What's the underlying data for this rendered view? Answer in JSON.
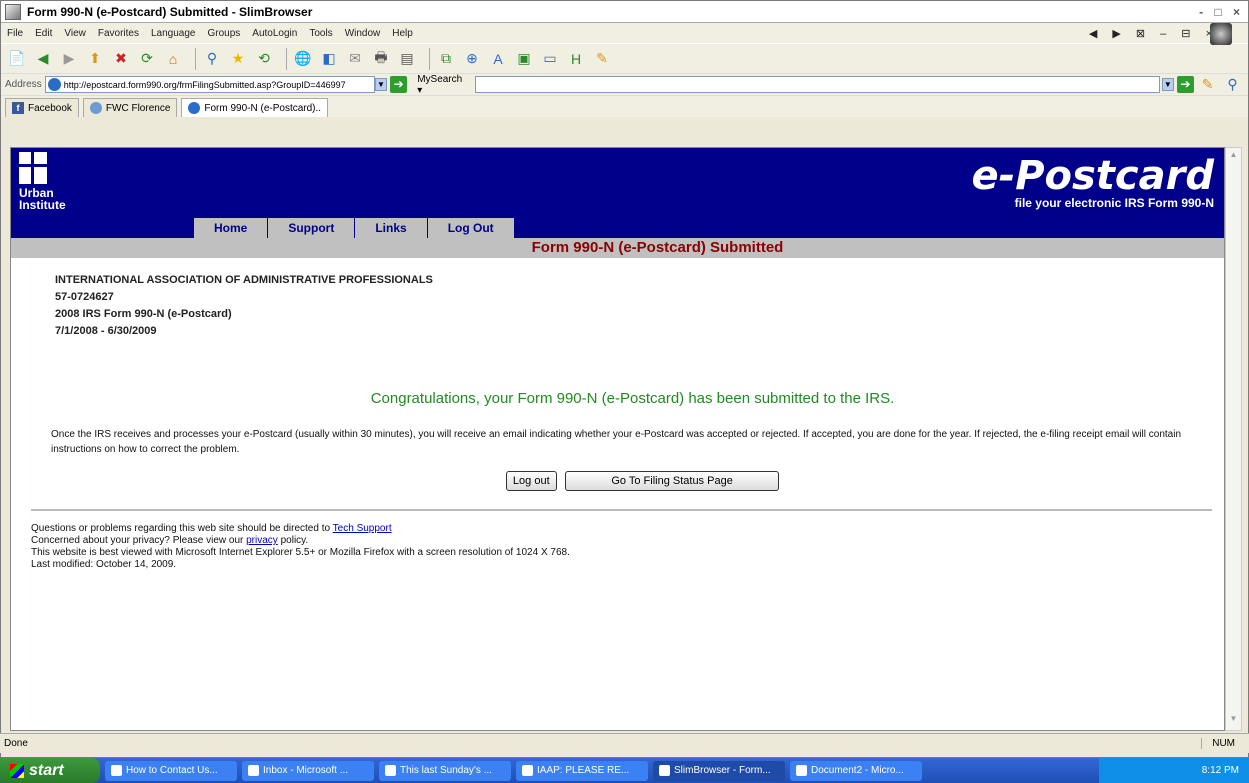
{
  "window": {
    "title": "Form 990-N (e-Postcard) Submitted - SlimBrowser",
    "controls": "- □ ×"
  },
  "menu": [
    "File",
    "Edit",
    "View",
    "Favorites",
    "Language",
    "Groups",
    "AutoLogin",
    "Tools",
    "Window",
    "Help"
  ],
  "menu_right_controls": "◀ ▶ ⊠ – ⊟ ×",
  "address": {
    "label": "Address",
    "url": "http://epostcard.form990.org/frmFilingSubmitted.asp?GroupID=446997",
    "search_label": "MySearch ▾"
  },
  "tabs": [
    {
      "label": "Facebook",
      "icon": "facebook-icon"
    },
    {
      "label": "FWC Florence",
      "icon": "globe-icon"
    },
    {
      "label": "Form 990-N (e-Postcard)..",
      "icon": "ie-page-icon"
    }
  ],
  "page": {
    "logo_text_1": "Urban",
    "logo_text_2": "Institute",
    "brand_title": "e-Postcard",
    "brand_sub": "file your electronic IRS Form 990-N",
    "nav": [
      "Home",
      "Support",
      "Links",
      "Log Out"
    ],
    "subheader": "Form 990-N (e-Postcard) Submitted",
    "org_name": "INTERNATIONAL ASSOCIATION OF ADMINISTRATIVE PROFESSIONALS",
    "ein": "57-0724627",
    "form_year": "2008 IRS Form 990-N (e-Postcard)",
    "period": "7/1/2008 - 6/30/2009",
    "congrats": "Congratulations, your Form 990-N (e-Postcard) has been submitted to the IRS.",
    "info": "Once the IRS receives and processes your e-Postcard (usually within 30 minutes), you will receive an email indicating whether your e-Postcard was accepted or rejected. If accepted, you are done for the year. If rejected, the e-filing receipt email will contain instructions on how to correct the problem.",
    "logout_btn": "Log out",
    "status_btn": "Go To Filing Status Page",
    "footer_q": "Questions or problems regarding this web site should be directed to",
    "footer_link_support": "Tech Support",
    "footer_priv_a": "Concerned about your privacy? Please view our",
    "footer_link_privacy": "privacy",
    "footer_priv_b": "policy.",
    "footer_best": "This website is best viewed with Microsoft Internet Explorer 5.5+ or Mozilla Firefox with a screen resolution of 1024 X 768.",
    "footer_modified": "Last modified: October 14, 2009."
  },
  "status": {
    "left": "Done",
    "right": "NUM"
  },
  "taskbar": {
    "start": "start",
    "items": [
      "How to Contact Us...",
      "Inbox - Microsoft ...",
      "This last Sunday's ...",
      "IAAP: PLEASE RE...",
      "SlimBrowser - Form...",
      "Document2 - Micro..."
    ],
    "active_index": 4,
    "clock": "8:12 PM"
  }
}
